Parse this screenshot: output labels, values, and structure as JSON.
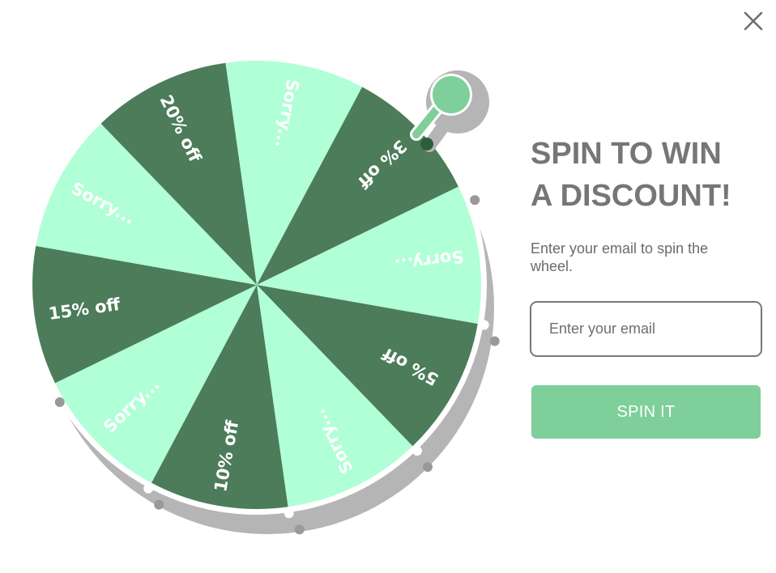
{
  "popup": {
    "title_line1": "SPIN TO WIN",
    "title_line2": "A DISCOUNT!",
    "subtitle": "Enter your email to spin the wheel.",
    "email_placeholder": "Enter your email",
    "spin_button_label": "SPIN IT",
    "close_icon": "close-icon"
  },
  "wheel": {
    "slices": [
      {
        "label": "3% off",
        "color": "#4c7c5a"
      },
      {
        "label": "Sorry...",
        "color": "#b0ffd6"
      },
      {
        "label": "5% off",
        "color": "#4c7c5a"
      },
      {
        "label": "Sorry...",
        "color": "#b0ffd6"
      },
      {
        "label": "10% off",
        "color": "#4c7c5a"
      },
      {
        "label": "Sorry...",
        "color": "#b0ffd6"
      },
      {
        "label": "15% off",
        "color": "#4c7c5a"
      },
      {
        "label": "Sorry...",
        "color": "#b0ffd6"
      },
      {
        "label": "20% off",
        "color": "#4c7c5a"
      },
      {
        "label": "Sorry...",
        "color": "#b0ffd6"
      }
    ],
    "rim_color": "#ffffff",
    "shadow_color": "#b5b5b5",
    "pointer_color": "#7ecf9a"
  },
  "colors": {
    "title": "#767676",
    "button": "#7ecf9a"
  }
}
